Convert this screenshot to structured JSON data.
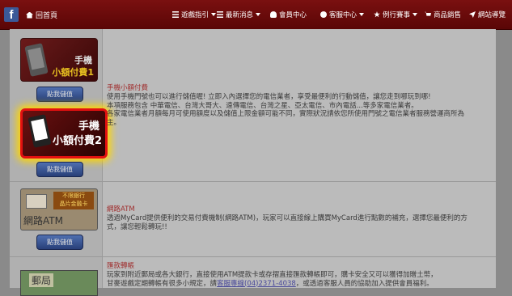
{
  "topbar": {
    "fb": "f",
    "home": "回首頁",
    "nav": [
      {
        "label": "遊戲指引",
        "icon": "bars-icon",
        "dropdown": true
      },
      {
        "label": "最新消息",
        "icon": "megaphone-icon",
        "dropdown": true
      },
      {
        "label": "會員中心",
        "icon": "user-icon",
        "dropdown": false
      },
      {
        "label": "客服中心",
        "icon": "help-icon",
        "dropdown": true
      },
      {
        "label": "例行賽事",
        "icon": "star-icon",
        "dropdown": true
      },
      {
        "label": "商品銷售",
        "icon": "cart-icon",
        "dropdown": false
      },
      {
        "label": "網站導覽",
        "icon": "send-icon",
        "dropdown": false
      }
    ]
  },
  "left": {
    "card1": {
      "title": "手機",
      "sub": "小額付費1"
    },
    "card2": {
      "title": "手機",
      "sub": "小額付費2"
    },
    "atm": {
      "box1": "不限銀行",
      "box2": "晶片金融卡",
      "title": "網路ATM"
    },
    "post": {
      "label": "郵局"
    },
    "button": "點我儲值"
  },
  "sections": {
    "mobile": {
      "title": "手機小額付費",
      "lines": [
        "使用手機門號也可以進行儲值喔! 立即入內選擇您的電信業者，享受最便利的行動儲值，讓您走到哪玩到哪!",
        "本項服務包含 中華電信、台灣大哥大、遠傳電信、台灣之星、亞太電信、市內電話...等多家電信業者。",
        "各家電信業者月額每月可使用額度以及儲值上限金額可能不同，實際狀況請依您所使用門號之電信業者服務營運商所為",
        "主。"
      ]
    },
    "atm": {
      "title": "網路ATM",
      "lines": [
        "透過MyCard提供便利的交易付費機制(網路ATM)，玩家可以直接線上購買MyCard進行點數的補充，選擇您最便利的方",
        "式，讓您輕鬆轉玩!!"
      ]
    },
    "remit": {
      "title": "匯款轉帳",
      "line1": "玩家到附近郵局或各大銀行，直接使用ATM提款卡或存摺直接匯款轉帳即可，購卡安全又可以獲得加贈土幣，",
      "line2_pre": "甘麥遊戲定期轉帳有很多小規定，請",
      "line2_link": "客服專線(04)2371-4038",
      "line2_post": "，或透過客服人員的協助加入提供會員福利。"
    }
  }
}
